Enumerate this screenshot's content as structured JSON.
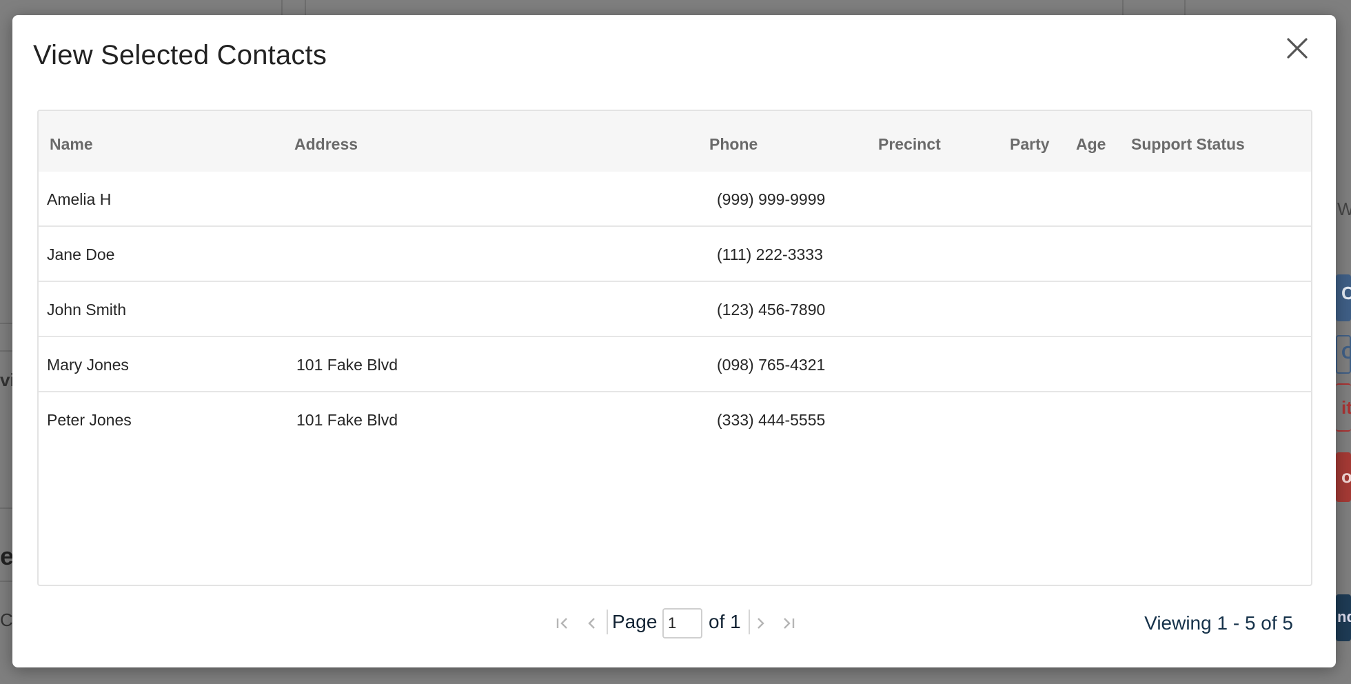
{
  "background": {
    "fragments": [
      "W",
      "C",
      "C",
      "ite",
      "ov",
      "vi",
      "er",
      "C",
      "nd"
    ]
  },
  "modal": {
    "title": "View Selected Contacts",
    "close_icon": "close-icon"
  },
  "table": {
    "columns": [
      "Name",
      "Address",
      "Phone",
      "Precinct",
      "Party",
      "Age",
      "Support Status"
    ],
    "rows": [
      {
        "name": "Amelia H",
        "address": "",
        "phone": "(999) 999-9999",
        "precinct": "",
        "party": "",
        "age": "",
        "support_status": ""
      },
      {
        "name": "Jane Doe",
        "address": "",
        "phone": "(111) 222-3333",
        "precinct": "",
        "party": "",
        "age": "",
        "support_status": ""
      },
      {
        "name": "John Smith",
        "address": "",
        "phone": "(123) 456-7890",
        "precinct": "",
        "party": "",
        "age": "",
        "support_status": ""
      },
      {
        "name": "Mary Jones",
        "address": "101 Fake Blvd",
        "phone": "(098) 765-4321",
        "precinct": "",
        "party": "",
        "age": "",
        "support_status": ""
      },
      {
        "name": "Peter Jones",
        "address": "101 Fake Blvd",
        "phone": "(333) 444-5555",
        "precinct": "",
        "party": "",
        "age": "",
        "support_status": ""
      }
    ]
  },
  "pager": {
    "page_label": "Page",
    "page_value": "1",
    "of_label": "of 1",
    "viewing": "Viewing 1 - 5 of 5",
    "icons": [
      "first-page-icon",
      "prev-page-icon",
      "next-page-icon",
      "last-page-icon"
    ]
  },
  "colors": {
    "overlay": "#7f7f7f",
    "header_bg": "#f6f6f6",
    "header_text": "#6a6a6a",
    "pager_text": "#16324a"
  }
}
